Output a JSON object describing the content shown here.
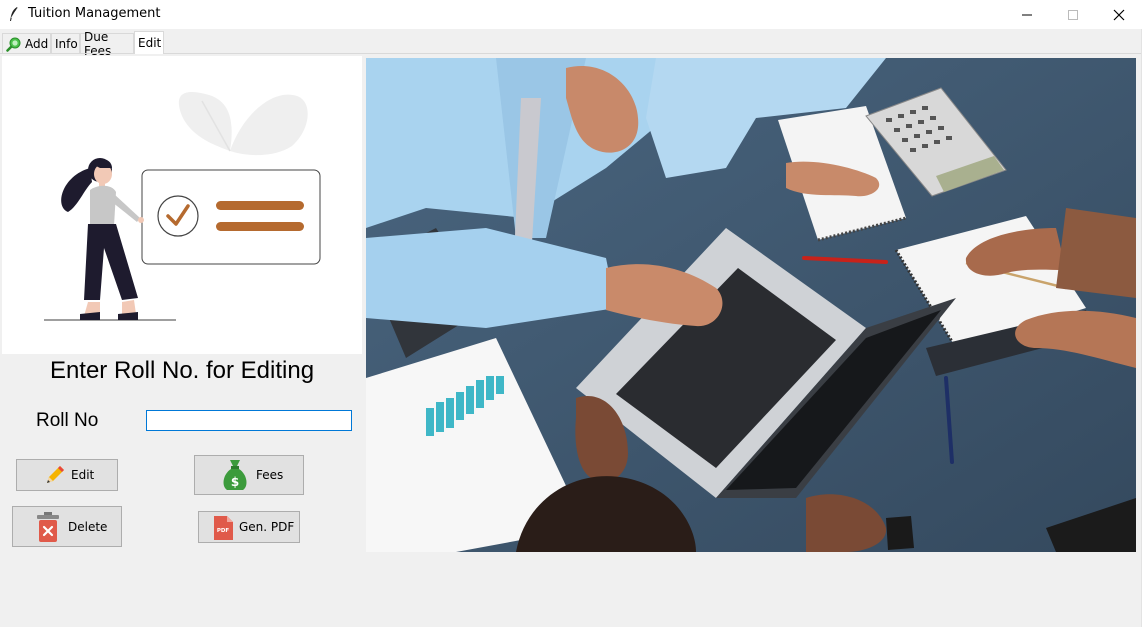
{
  "window": {
    "title": "Tuition Management",
    "controls": {
      "minimize": "minimize",
      "maximize": "maximize",
      "close": "close"
    }
  },
  "tabs": [
    {
      "label": "Add",
      "icon": "search-icon",
      "selected": false
    },
    {
      "label": "Info",
      "selected": false
    },
    {
      "label": "Due Fees",
      "selected": false
    },
    {
      "label": "Edit",
      "selected": true
    }
  ],
  "form": {
    "heading": "Enter Roll No. for Editing",
    "roll_label": "Roll No",
    "roll_value": ""
  },
  "buttons": {
    "edit": {
      "label": "Edit",
      "icon": "pencil-icon"
    },
    "fees": {
      "label": "Fees",
      "icon": "money-bag-icon"
    },
    "delete": {
      "label": "Delete",
      "icon": "trash-icon"
    },
    "pdf": {
      "label": "Gen. PDF",
      "icon": "pdf-file-icon",
      "icon_text": "PDF"
    }
  },
  "colors": {
    "accent_brown": "#b56a2f",
    "input_focus": "#0078d7",
    "money_green": "#3c9b3c",
    "delete_red": "#e05a4a"
  }
}
